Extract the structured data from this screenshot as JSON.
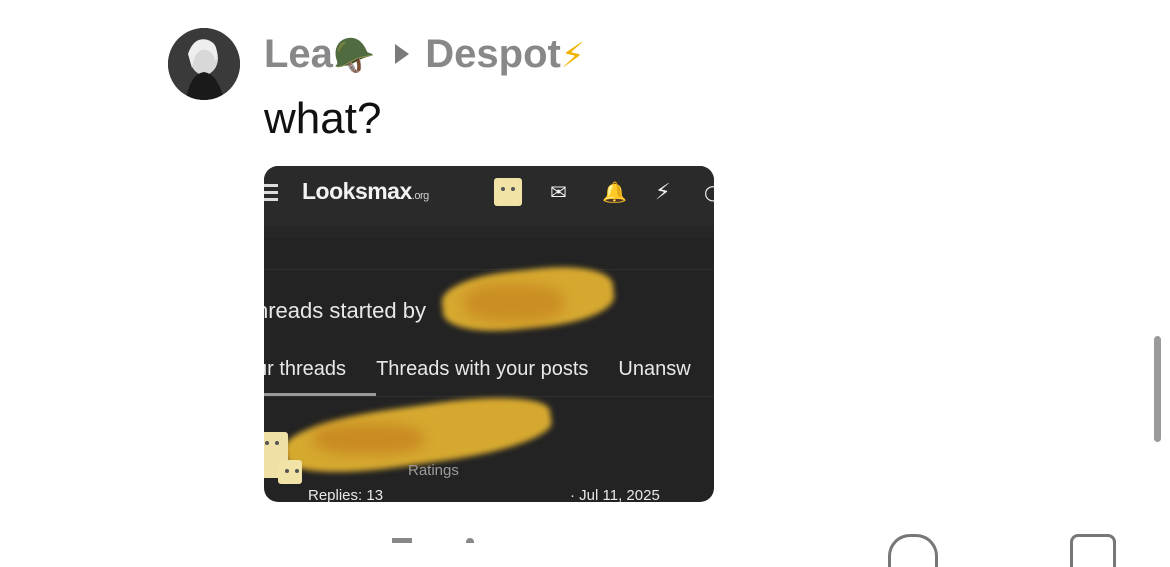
{
  "post": {
    "author": "Lea",
    "author_emoji": "🪖",
    "recipient": "Despot",
    "recipient_emoji": "⚡",
    "text": "what?"
  },
  "screenshot": {
    "logo_main": "Looksmax",
    "logo_suffix": ".org",
    "heading": "hreads started by",
    "tabs": [
      "ur threads",
      "Threads with your posts",
      "Unansw"
    ],
    "ratings_label": "Ratings",
    "replies": "Replies: 13",
    "date": "· Jul 11, 2025",
    "nav_icons": [
      "avatar-icon",
      "mail-icon",
      "bell-icon",
      "lightning-icon",
      "search-icon"
    ]
  },
  "colors": {
    "name_gray": "#888888",
    "screenshot_bg": "#232323",
    "smudge": "#e0b030"
  }
}
